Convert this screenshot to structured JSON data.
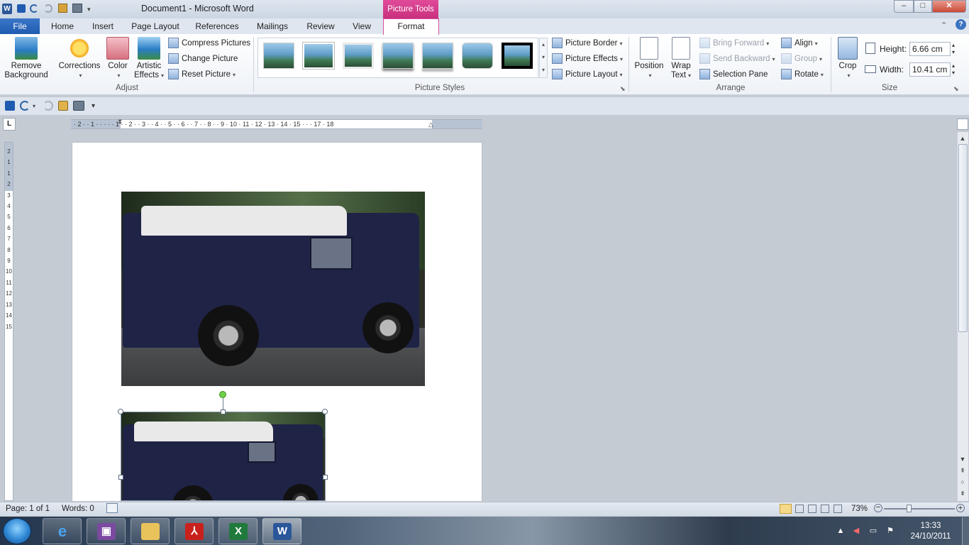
{
  "window": {
    "title": "Document1  -  Microsoft Word",
    "app_icon": "W",
    "context_tab": "Picture Tools",
    "minimize": "–",
    "maximize": "□",
    "close": "✕"
  },
  "tabs": {
    "file": "File",
    "items": [
      "Home",
      "Insert",
      "Page Layout",
      "References",
      "Mailings",
      "Review",
      "View"
    ],
    "active": "Format"
  },
  "ribbon": {
    "adjust": {
      "remove_background": [
        "Remove",
        "Background"
      ],
      "corrections": "Corrections",
      "color": "Color",
      "artistic_effects": [
        "Artistic",
        "Effects"
      ],
      "compress": "Compress Pictures",
      "change": "Change Picture",
      "reset": "Reset Picture",
      "group_label": "Adjust"
    },
    "picture_styles": {
      "thumb_count": 7,
      "picture_border": "Picture Border",
      "picture_effects": "Picture Effects",
      "picture_layout": "Picture Layout",
      "group_label": "Picture Styles"
    },
    "arrange": {
      "position": "Position",
      "wrap_text": [
        "Wrap",
        "Text"
      ],
      "bring_forward": "Bring Forward",
      "send_backward": "Send Backward",
      "selection_pane": "Selection Pane",
      "align": "Align",
      "group": "Group",
      "rotate": "Rotate",
      "group_label": "Arrange"
    },
    "crop": "Crop",
    "size": {
      "height_label": "Height:",
      "height_value": "6.66 cm",
      "width_label": "Width:",
      "width_value": "10.41 cm",
      "group_label": "Size"
    }
  },
  "ruler": {
    "horizontal": "· 2 · · 1 · · · · · 1 · · 2 · · 3 · · 4 · · 5 · · 6 · · 7 · · 8 · · 9 · 10 · 11 · 12 · 13 · 14 · 15 · · · 17 · 18",
    "vertical": [
      "2",
      "1",
      "",
      "1",
      "2",
      "3",
      "4",
      "5",
      "6",
      "7",
      "8",
      "9",
      "10",
      "11",
      "12",
      "13",
      "14",
      "15"
    ]
  },
  "document": {
    "images": [
      {
        "name": "van-photo-1",
        "selected": false
      },
      {
        "name": "van-photo-2",
        "selected": true
      }
    ]
  },
  "status": {
    "page": "Page: 1 of 1",
    "words": "Words: 0",
    "zoom": "73%",
    "zoom_fraction": 0.36
  },
  "taskbar": {
    "apps": [
      "Internet Explorer",
      "Media",
      "Windows Explorer",
      "Adobe Reader",
      "Microsoft Excel",
      "Microsoft Word"
    ],
    "time": "13:33",
    "date": "24/10/2011"
  },
  "colors": {
    "accent": "#2b579a",
    "context": "#d94fa0",
    "file_tab": "#2a66b9"
  }
}
